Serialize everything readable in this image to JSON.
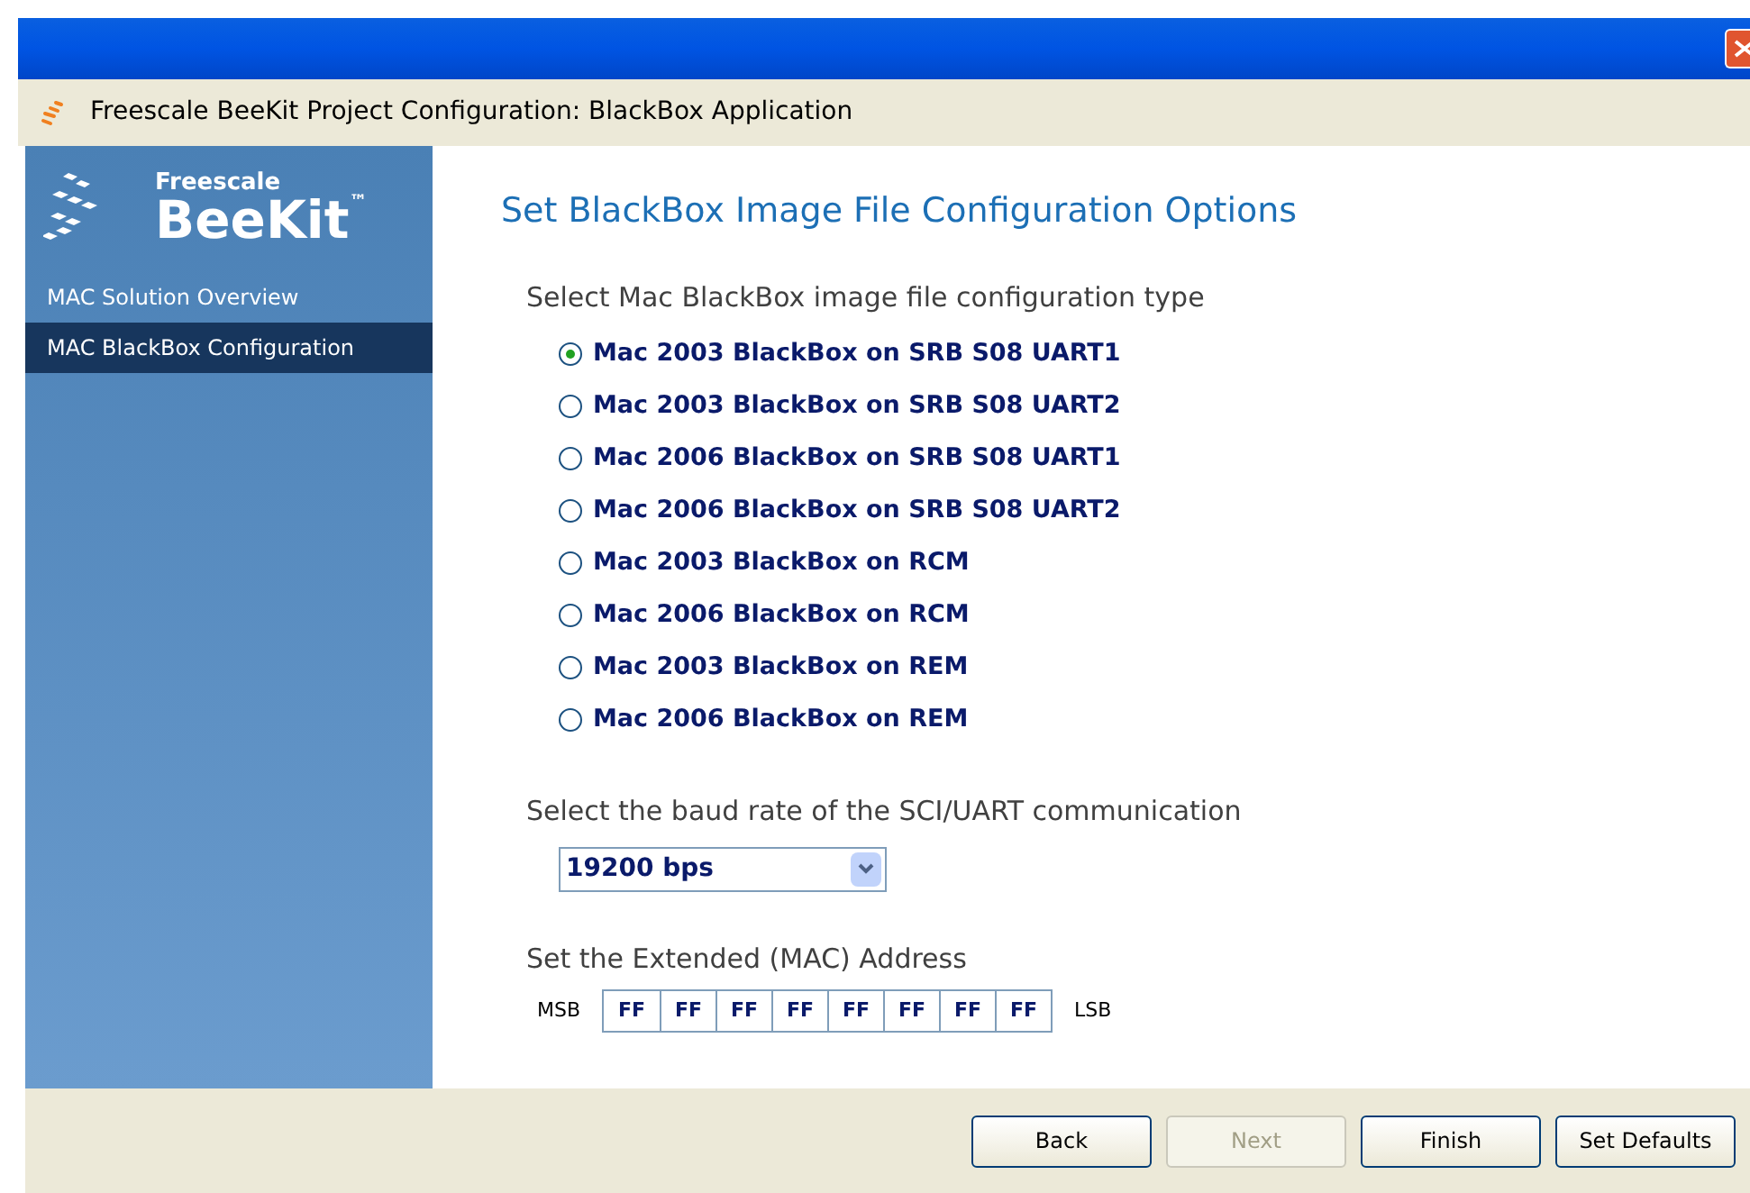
{
  "window": {
    "title": "Freescale BeeKit Project Configuration: BlackBox Application"
  },
  "logo": {
    "brand": "Freescale",
    "product": "BeeKit",
    "mark": "™"
  },
  "sidebar": {
    "items": [
      {
        "label": "MAC Solution Overview",
        "selected": false
      },
      {
        "label": "MAC BlackBox Configuration",
        "selected": true
      }
    ]
  },
  "page": {
    "heading": "Set BlackBox Image File Configuration Options",
    "image_type": {
      "label": "Select Mac BlackBox image file configuration type",
      "options": [
        {
          "label": "Mac 2003 BlackBox on SRB S08 UART1",
          "selected": true
        },
        {
          "label": "Mac 2003 BlackBox on SRB S08 UART2",
          "selected": false
        },
        {
          "label": "Mac 2006 BlackBox on SRB S08 UART1",
          "selected": false
        },
        {
          "label": "Mac 2006 BlackBox on SRB S08 UART2",
          "selected": false
        },
        {
          "label": "Mac 2003 BlackBox on RCM",
          "selected": false
        },
        {
          "label": "Mac 2006 BlackBox on RCM",
          "selected": false
        },
        {
          "label": "Mac 2003 BlackBox on REM",
          "selected": false
        },
        {
          "label": "Mac 2006 BlackBox on REM",
          "selected": false
        }
      ]
    },
    "baud_rate": {
      "label": "Select the baud rate of the SCI/UART communication",
      "value": "19200 bps"
    },
    "address": {
      "label": "Set the Extended (MAC) Address",
      "msb": "MSB",
      "lsb": "LSB",
      "bytes": [
        "FF",
        "FF",
        "FF",
        "FF",
        "FF",
        "FF",
        "FF",
        "FF"
      ]
    }
  },
  "buttons": [
    {
      "label": "Back",
      "disabled": false
    },
    {
      "label": "Next",
      "disabled": true
    },
    {
      "label": "Finish",
      "disabled": false
    },
    {
      "label": "Set Defaults",
      "disabled": false
    }
  ]
}
